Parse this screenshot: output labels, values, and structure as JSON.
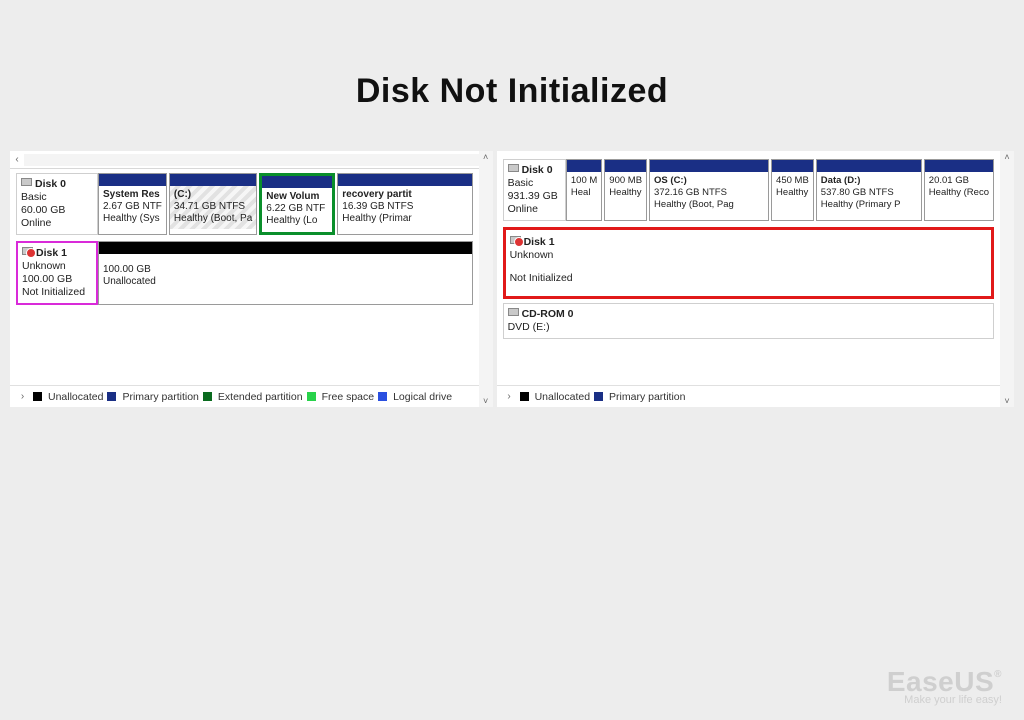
{
  "title": "Disk Not Initialized",
  "brand": {
    "name": "EaseUS",
    "tagline": "Make your life easy!"
  },
  "left": {
    "disk0": {
      "name": "Disk 0",
      "type": "Basic",
      "size": "60.00 GB",
      "status": "Online"
    },
    "disk0_parts": [
      {
        "label": "System Res",
        "size": "2.67 GB NTF",
        "status": "Healthy (Sys"
      },
      {
        "label": "(C:)",
        "size": "34.71 GB NTFS",
        "status": "Healthy (Boot, Pa"
      },
      {
        "label": "New Volum",
        "size": "6.22 GB NTF",
        "status": "Healthy (Lo"
      },
      {
        "label": "recovery partit",
        "size": "16.39 GB NTFS",
        "status": "Healthy (Primar"
      }
    ],
    "disk1": {
      "name": "Disk 1",
      "type": "Unknown",
      "size": "100.00 GB",
      "status": "Not Initialized"
    },
    "disk1_part": {
      "size": "100.00 GB",
      "status": "Unallocated"
    },
    "legend": [
      "Unallocated",
      "Primary partition",
      "Extended partition",
      "Free space",
      "Logical drive"
    ]
  },
  "right": {
    "disk0": {
      "name": "Disk 0",
      "type": "Basic",
      "size": "931.39 GB",
      "status": "Online"
    },
    "disk0_parts": [
      {
        "label": "",
        "size": "100 M",
        "status": "Heal"
      },
      {
        "label": "",
        "size": "900 MB",
        "status": "Healthy"
      },
      {
        "label": "OS  (C:)",
        "size": "372.16 GB NTFS",
        "status": "Healthy (Boot, Pag"
      },
      {
        "label": "",
        "size": "450 MB",
        "status": "Healthy"
      },
      {
        "label": "Data  (D:)",
        "size": "537.80 GB NTFS",
        "status": "Healthy (Primary P"
      },
      {
        "label": "",
        "size": "20.01 GB",
        "status": "Healthy (Reco"
      }
    ],
    "disk1": {
      "name": "Disk 1",
      "type": "Unknown",
      "size": "",
      "status": "Not Initialized"
    },
    "cdrom": {
      "name": "CD-ROM 0",
      "label": "DVD (E:)"
    },
    "legend": [
      "Unallocated",
      "Primary partition"
    ]
  }
}
